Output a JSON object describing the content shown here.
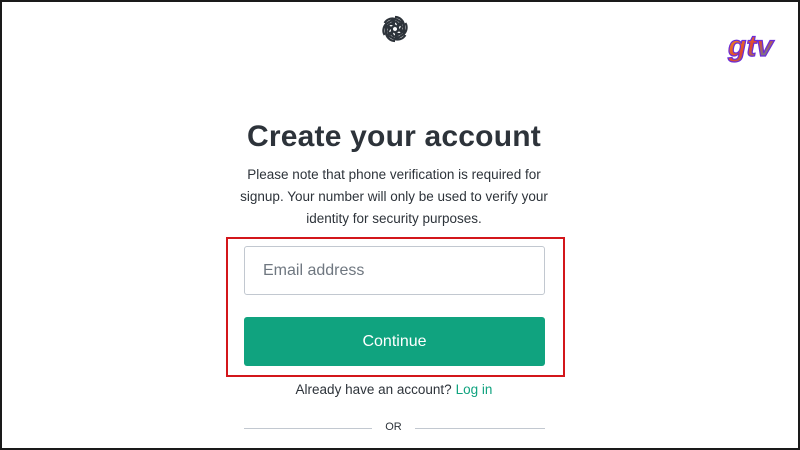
{
  "logo": {
    "icon": "openai-logo-icon"
  },
  "watermark": {
    "text": "gtv",
    "colors": [
      "#6a2bd9",
      "#f2a21c",
      "#1e9be0"
    ]
  },
  "header": {
    "title": "Create your account",
    "subtitle": "Please note that phone verification is required for signup. Your number will only be used to verify your identity for security purposes."
  },
  "form": {
    "email_placeholder": "Email address",
    "email_value": "",
    "continue_label": "Continue"
  },
  "login": {
    "prompt": "Already have an account?",
    "link_label": "Log in"
  },
  "divider": {
    "label": "OR"
  },
  "colors": {
    "accent": "#10a37f",
    "highlight_border": "#d3161b",
    "text": "#2d333a",
    "input_border": "#c2c8d0"
  }
}
